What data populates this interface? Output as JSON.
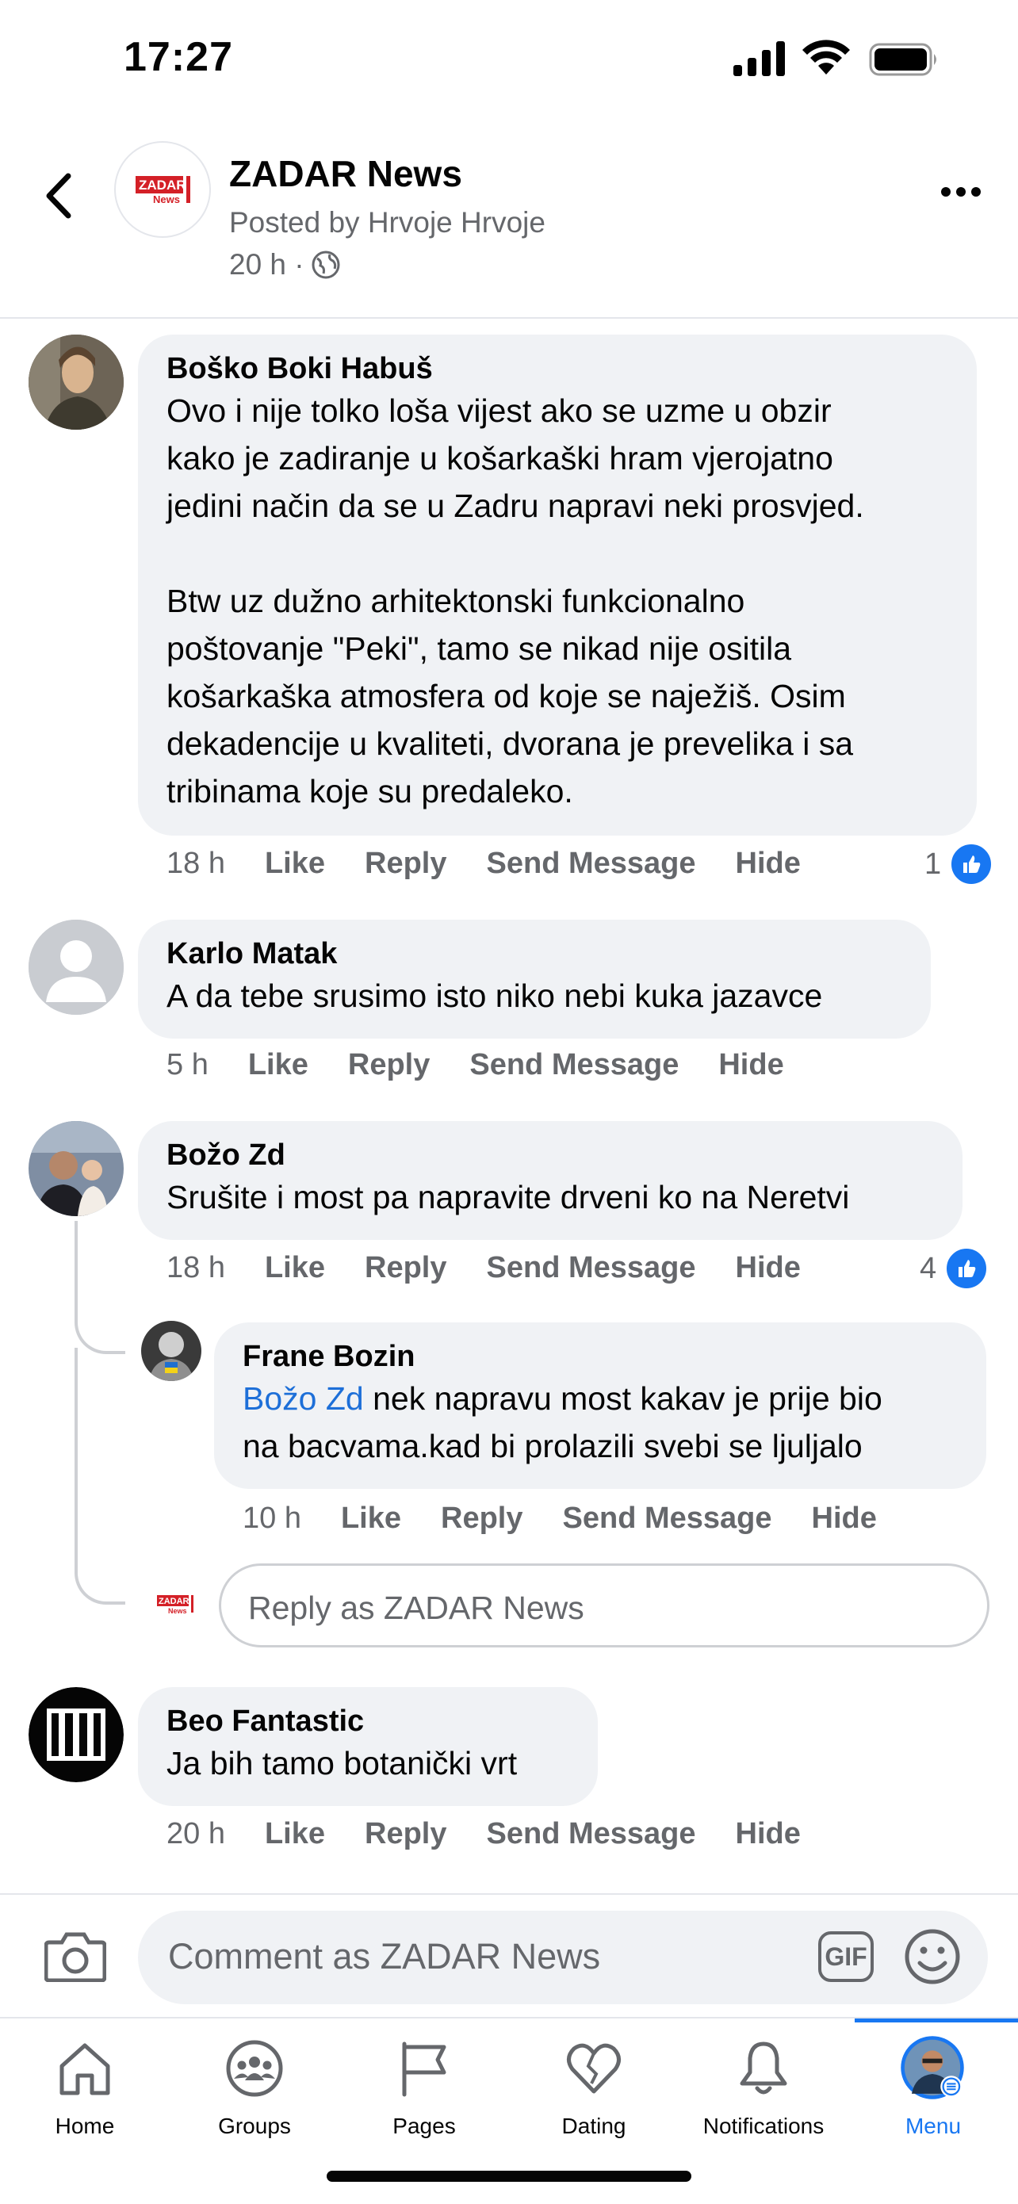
{
  "status_bar": {
    "time": "17:27"
  },
  "header": {
    "page_name": "ZADAR News",
    "posted_by": "Posted by Hrvoje Hrvoje",
    "time": "20 h ·",
    "logo_text": "ZADAR News"
  },
  "comments": [
    {
      "author": "Boško Boki Habuš",
      "text": "Ovo i nije tolko loša vijest ako se uzme u obzir\nkako je zadiranje u košarkaški hram vjerojatno\njedini način da se u Zadru napravi neki prosvjed.\n\nBtw uz dužno arhitektonski funkcionalno\npoštovanje \"Peki\", tamo se nikad nije ositila\nkošarkaška atmosfera od koje se naježiš. Osim\ndekadencije u kvaliteti, dvorana je prevelika i sa\ntribinama koje su predaleko.",
      "time": "18 h",
      "like": "Like",
      "reply": "Reply",
      "send": "Send Message",
      "hide": "Hide",
      "reactions": "1"
    },
    {
      "author": "Karlo Matak",
      "text": "A da tebe srusimo isto niko nebi kuka jazavce",
      "time": "5 h",
      "like": "Like",
      "reply": "Reply",
      "send": "Send Message",
      "hide": "Hide"
    },
    {
      "author": "Božo Zd",
      "text": "Srušite i most pa napravite drveni ko na Neretvi",
      "time": "18 h",
      "like": "Like",
      "reply": "Reply",
      "send": "Send Message",
      "hide": "Hide",
      "reactions": "4"
    },
    {
      "author": "Frane Bozin",
      "mention": "Božo Zd",
      "text": " nek napravu most kakav je prije bio\nna bacvama.kad bi prolazili svebi se ljuljalo",
      "time": "10 h",
      "like": "Like",
      "reply": "Reply",
      "send": "Send Message",
      "hide": "Hide"
    },
    {
      "author": "Beo Fantastic",
      "text": "Ja bih tamo botanički vrt",
      "time": "20 h",
      "like": "Like",
      "reply": "Reply",
      "send": "Send Message",
      "hide": "Hide"
    }
  ],
  "reply_box": {
    "placeholder": "Reply as ZADAR News"
  },
  "composer": {
    "placeholder": "Comment as ZADAR News",
    "gif": "GIF"
  },
  "tabs": [
    {
      "label": "Home"
    },
    {
      "label": "Groups"
    },
    {
      "label": "Pages"
    },
    {
      "label": "Dating"
    },
    {
      "label": "Notifications"
    },
    {
      "label": "Menu"
    }
  ],
  "colors": {
    "accent": "#1877f2",
    "bubble": "#f0f2f5",
    "secondary_text": "#65676b"
  }
}
